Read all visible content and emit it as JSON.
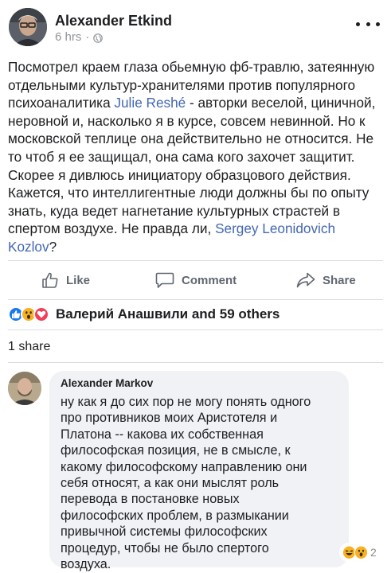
{
  "post": {
    "author": "Alexander Etkind",
    "time": "6 hrs",
    "separator": "·",
    "text_parts": {
      "p1": "Посмотрел краем глаза обьемную фб-травлю, затеянную\nотдельными культур-хранителями против популярного\nпсихоаналитика ",
      "mention1": "Julie Reshé",
      "p2": " - авторки веселой, циничной,\nнеровной и, насколько я в курсе, совсем невинной. Но к\nмосковской теплице она действительно не относится. Не\nто чтоб я ее защищал, она сама кого захочет защитит.\nСкорее я дивлюсь инициатору образцового действия.\nКажется, что интеллигентные люди должны бы по опыту\nзнать, куда ведет нагнетание культурных страстей в\nспертом воздухе. Не правда ли, ",
      "mention2": "Sergey Leonidovich\nKozlov",
      "p3": "?"
    }
  },
  "actions": {
    "like": "Like",
    "comment": "Comment",
    "share": "Share"
  },
  "reactions": {
    "summary": "Валерий Анашвили and 59 others"
  },
  "shares": "1 share",
  "comment": {
    "author": "Alexander Markov",
    "text": "ну как я до сих пор не могу понять одного\nпро противников моих Аристотеля и\nПлатона -- какова их собственная\nфилософская позиция, не в смысле, к\nкакому философскому направлению они\nсебя относят, а как они мыслят роль\nперевода в постановке новых\nфилософских проблем, в размыкании\nпривычной системы философских\nпроцедур, чтобы не было спертого\nвоздуха.",
    "reaction_count": "2"
  },
  "colors": {
    "link": "#4267b2",
    "secondary": "#606770",
    "like_blue": "#1877f2",
    "love_red": "#f33e58",
    "wow_yellow": "#f7b125"
  },
  "icons": [
    "globe-icon",
    "more-icon",
    "like-icon",
    "comment-icon",
    "share-icon",
    "like-reaction-icon",
    "wow-reaction-icon",
    "love-reaction-icon",
    "haha-reaction-icon"
  ]
}
